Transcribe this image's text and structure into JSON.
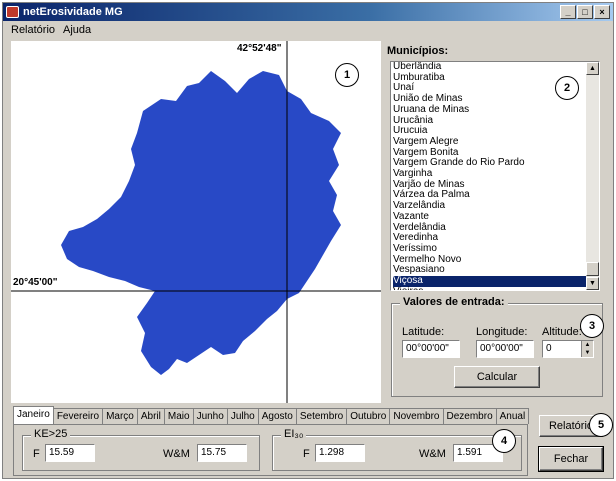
{
  "window": {
    "title": "netErosividade MG",
    "min": "_",
    "max": "□",
    "close": "×"
  },
  "menu": {
    "items": [
      "Relatório",
      "Ajuda"
    ]
  },
  "map": {
    "longitude_label": "42°52'48\"",
    "latitude_label": "20°45'00\"",
    "region_color": "#2849c6",
    "crosshair_color": "#000000"
  },
  "callouts": [
    "1",
    "2",
    "3",
    "4",
    "5"
  ],
  "municipios": {
    "label": "Municípios:",
    "items": [
      "Uberlândia",
      "Umburatiba",
      "Unaí",
      "União de Minas",
      "Uruana de Minas",
      "Urucânia",
      "Urucuia",
      "Vargem Alegre",
      "Vargem Bonita",
      "Vargem Grande do Rio Pardo",
      "Varginha",
      "Varjão de Minas",
      "Várzea da Palma",
      "Varzelândia",
      "Vazante",
      "Verdelândia",
      "Veredinha",
      "Veríssimo",
      "Vermelho Novo",
      "Vespasiano",
      "Viçosa",
      "Vieiras"
    ],
    "selected": "Viçosa"
  },
  "entrada": {
    "title": "Valores de entrada:",
    "latitude_label": "Latitude:",
    "latitude_value": "00°00'00\"",
    "longitude_label": "Longitude:",
    "longitude_value": "00°00'00\"",
    "altitude_label": "Altitude:",
    "altitude_value": "0",
    "calcular": "Calcular"
  },
  "tabs": [
    "Janeiro",
    "Fevereiro",
    "Março",
    "Abril",
    "Maio",
    "Junho",
    "Julho",
    "Agosto",
    "Setembro",
    "Outubro",
    "Novembro",
    "Dezembro",
    "Anual"
  ],
  "active_tab": "Janeiro",
  "results": {
    "ke_title": "KE>25",
    "ke_f_label": "F",
    "ke_f_value": "15.59",
    "ke_wm_label": "W&M",
    "ke_wm_value": "15.75",
    "ei_title": "EI₃₀",
    "ei_f_label": "F",
    "ei_f_value": "1.298",
    "ei_wm_label": "W&M",
    "ei_wm_value": "1.591"
  },
  "buttons": {
    "relatorio": "Relatório",
    "fechar": "Fechar"
  }
}
